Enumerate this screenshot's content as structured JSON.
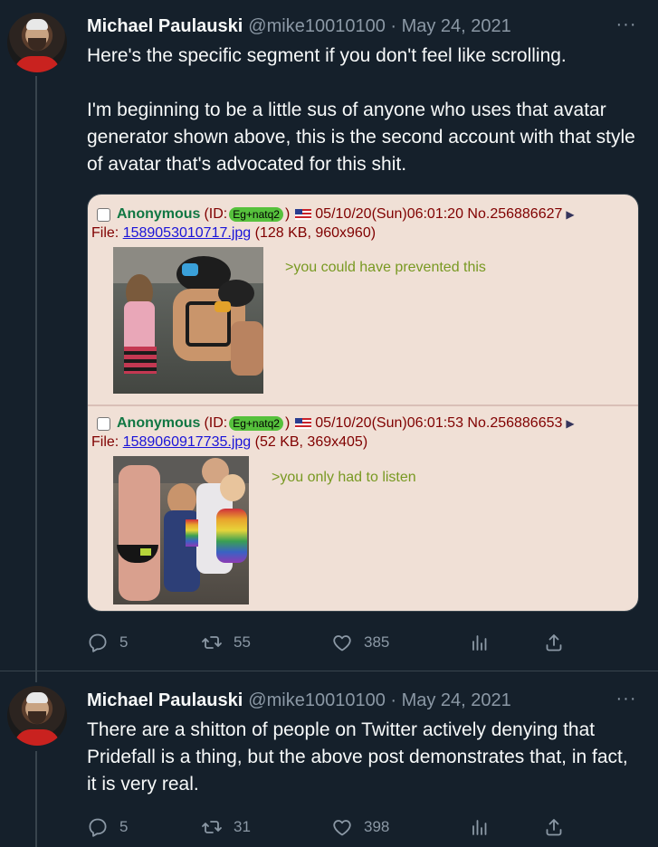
{
  "tweets": [
    {
      "author_name": "Michael Paulauski",
      "author_handle_date": "@mike10010100 · May 24, 2021",
      "more_label": "···",
      "text_lines": [
        "Here's the specific segment if you don't feel like scrolling.",
        "I'm beginning to be a little sus of anyone who uses that avatar generator shown above, this is the second account with that style of avatar that's advocated for this shit."
      ],
      "actions": {
        "reply_count": "5",
        "retweet_count": "55",
        "like_count": "385"
      }
    },
    {
      "author_name": "Michael Paulauski",
      "author_handle_date": "@mike10010100 · May 24, 2021",
      "more_label": "···",
      "text_lines": [
        "There are a shitton of people on Twitter actively denying that Pridefall is a thing, but the above post demonstrates that, in fact, it is very real."
      ],
      "actions": {
        "reply_count": "5",
        "retweet_count": "31",
        "like_count": "398"
      }
    }
  ],
  "screenshot_card": {
    "posts": [
      {
        "name": "Anonymous",
        "id_prefix": "(ID:",
        "id": "Eg+natq2",
        "id_suffix": ")",
        "datetime": "05/10/20(Sun)06:01:20 No.256886627",
        "arrow": "▶",
        "file_prefix": "File:",
        "file_name": "1589053010717.jpg",
        "file_info": "(128 KB, 960x960)",
        "greentext": ">you could have prevented this"
      },
      {
        "name": "Anonymous",
        "id_prefix": "(ID:",
        "id": "Eg+natq2",
        "id_suffix": ")",
        "datetime": "05/10/20(Sun)06:01:53 No.256886653",
        "arrow": "▶",
        "file_prefix": "File:",
        "file_name": "1589060917735.jpg",
        "file_info": "(52 KB, 369x405)",
        "greentext": ">you only had to listen"
      }
    ],
    "colors": {
      "background": "#f0e0d6",
      "name": "#117743",
      "greentext": "#789922",
      "link": "#1a14d8",
      "id_badge": "#56c13c"
    }
  },
  "icons": {
    "reply": "reply-icon",
    "retweet": "retweet-icon",
    "like": "like-icon",
    "views": "views-icon",
    "share": "share-icon"
  }
}
